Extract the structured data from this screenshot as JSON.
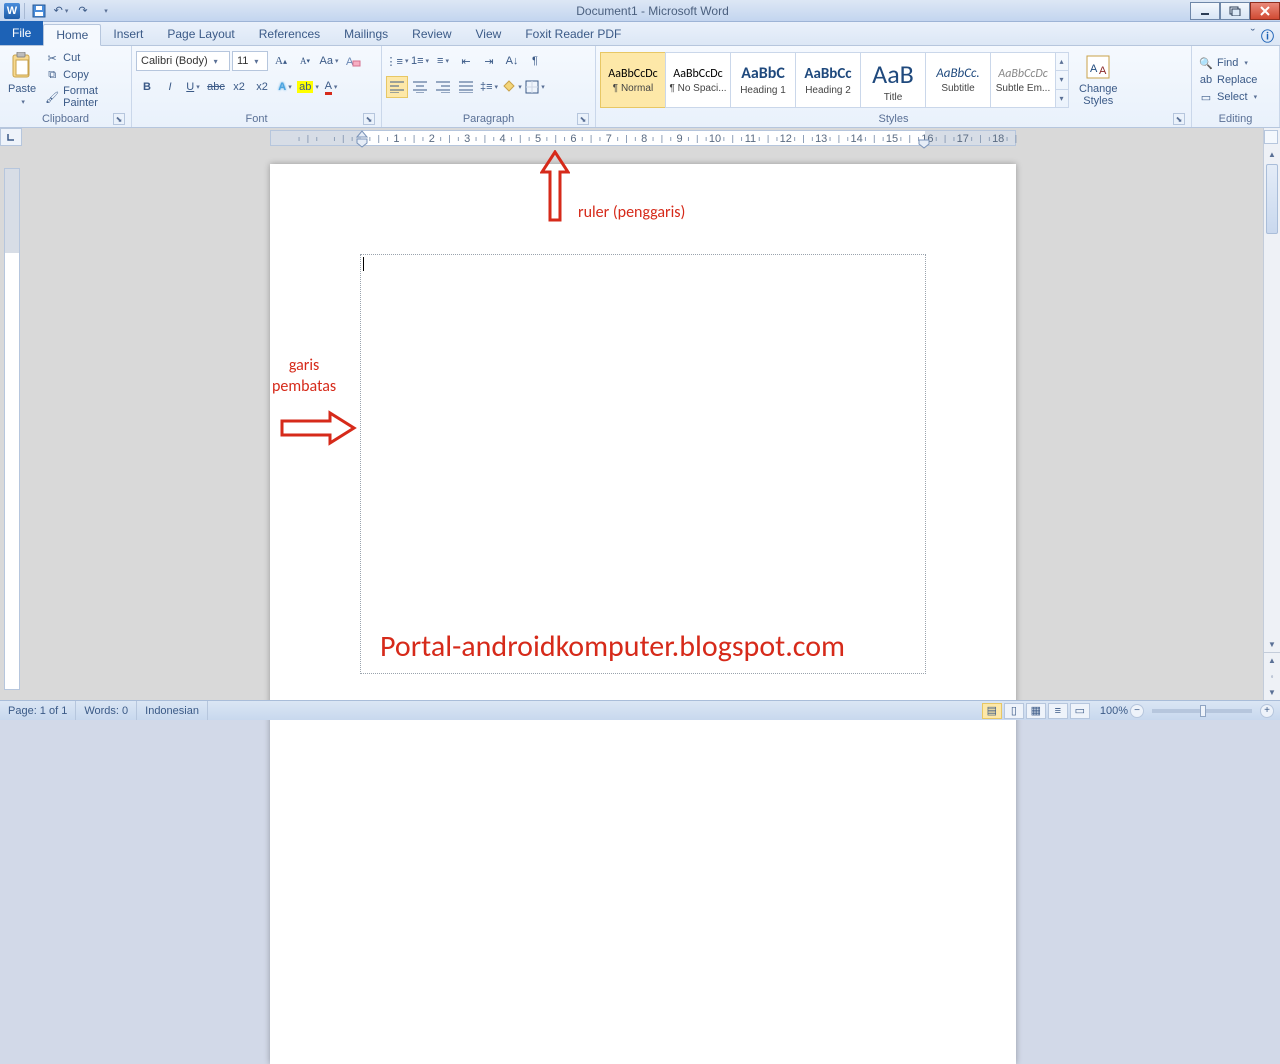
{
  "title": "Document1 - Microsoft Word",
  "tabs": {
    "file": "File",
    "home": "Home",
    "insert": "Insert",
    "pageLayout": "Page Layout",
    "references": "References",
    "mailings": "Mailings",
    "review": "Review",
    "view": "View",
    "foxit": "Foxit Reader PDF"
  },
  "clipboard": {
    "paste": "Paste",
    "cut": "Cut",
    "copy": "Copy",
    "formatPainter": "Format Painter",
    "label": "Clipboard"
  },
  "font": {
    "name": "Calibri (Body)",
    "size": "11",
    "label": "Font"
  },
  "paragraph": {
    "label": "Paragraph"
  },
  "styles": {
    "label": "Styles",
    "changeStyles": "Change\nStyles",
    "items": [
      {
        "preview": "AaBbCcDc",
        "name": "¶ Normal",
        "cls": "p1"
      },
      {
        "preview": "AaBbCcDc",
        "name": "¶ No Spaci...",
        "cls": "p1"
      },
      {
        "preview": "AaBbC",
        "name": "Heading 1",
        "cls": "h1"
      },
      {
        "preview": "AaBbCc",
        "name": "Heading 2",
        "cls": "h2"
      },
      {
        "preview": "AaB",
        "name": "Title",
        "cls": "ti"
      },
      {
        "preview": "AaBbCc.",
        "name": "Subtitle",
        "cls": "st"
      },
      {
        "preview": "AaBbCcDc",
        "name": "Subtle Em...",
        "cls": "se"
      }
    ]
  },
  "editing": {
    "find": "Find",
    "replace": "Replace",
    "select": "Select",
    "label": "Editing"
  },
  "annotations": {
    "ruler": "ruler (penggaris)",
    "garis": "garis\npembatas",
    "watermark": "Portal-androidkomputer.blogspot.com"
  },
  "status": {
    "page": "Page: 1 of 1",
    "words": "Words: 0",
    "lang": "Indonesian",
    "zoom": "100%"
  }
}
